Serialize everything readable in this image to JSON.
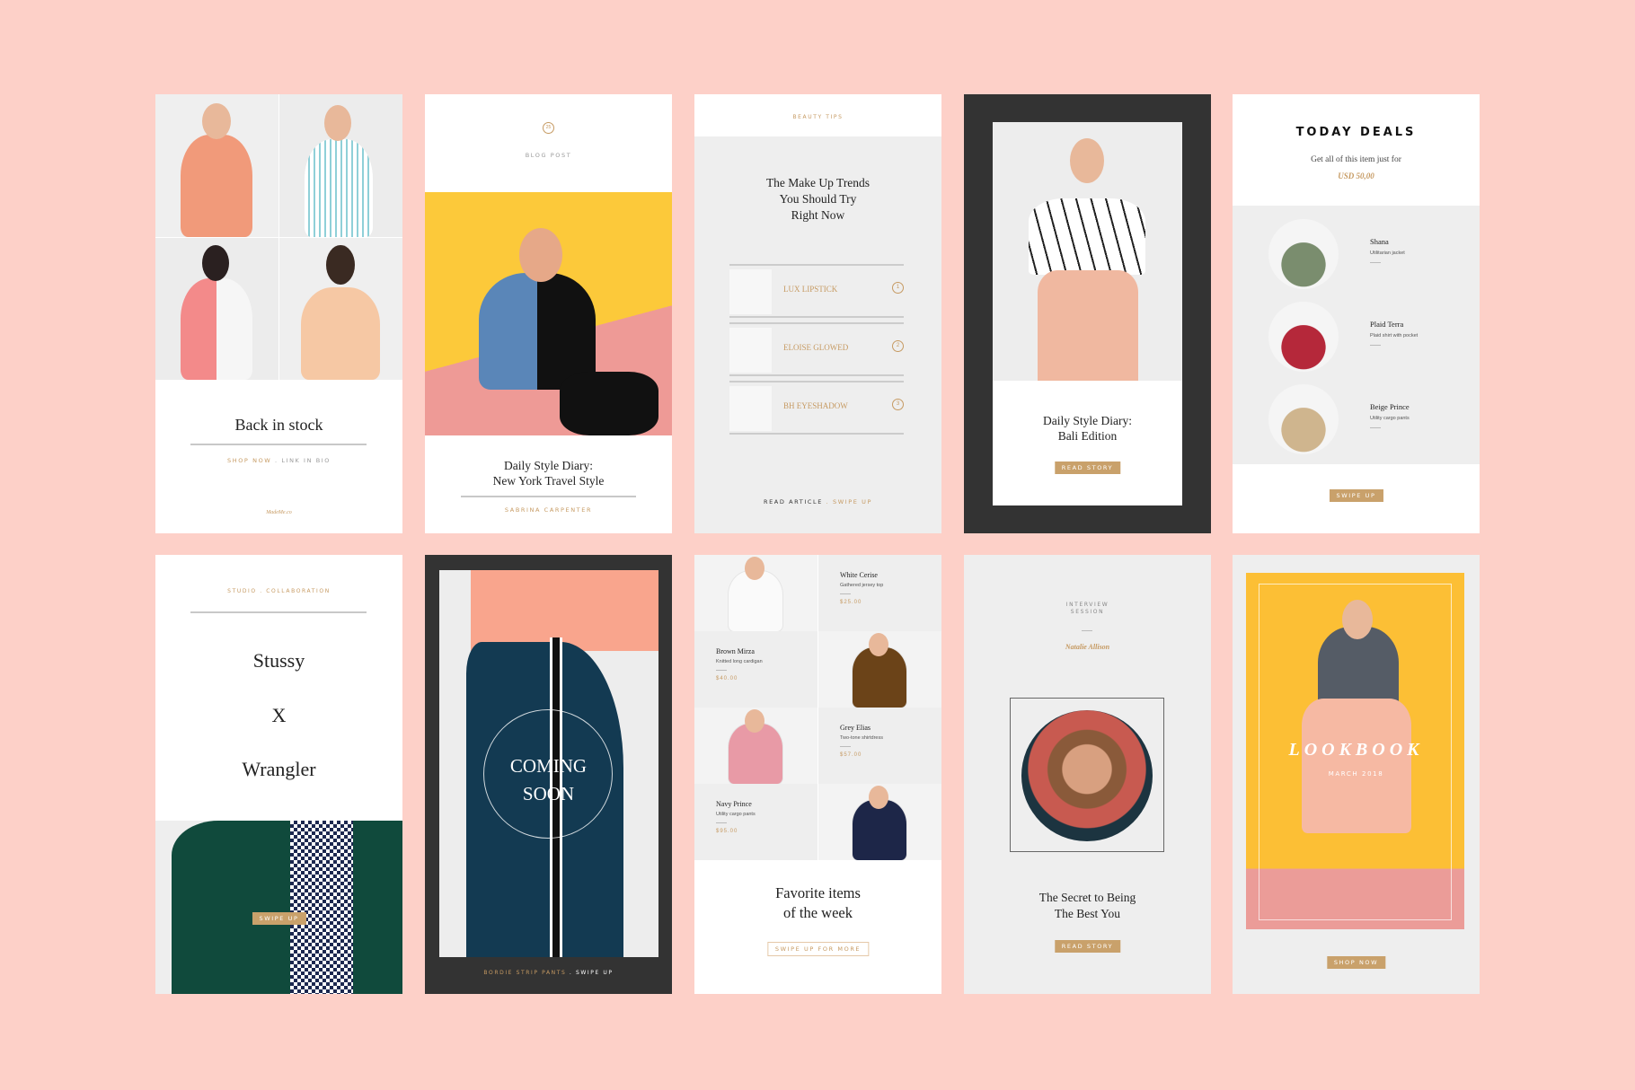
{
  "colors": {
    "background": "#fdd0c8",
    "accent": "#c9a16b",
    "dark": "#333333",
    "panel": "#eeeeee"
  },
  "back_in_stock": {
    "title": "Back in stock",
    "link_primary": "SHOP NOW",
    "link_sep": " . ",
    "link_secondary": "LINK IN BIO",
    "brand": "MadeMe.co"
  },
  "blog_post": {
    "badge": "25",
    "label": "BLOG POST",
    "title_line1": "Daily Style Diary:",
    "title_line2": "New York Travel Style",
    "author": "SABRINA CARPENTER"
  },
  "beauty_tips": {
    "label": "BEAUTY TIPS",
    "title_line1": "The Make Up Trends",
    "title_line2": "You Should Try",
    "title_line3": "Right Now",
    "items": [
      {
        "name": "LUX LIPSTICK",
        "number": "1"
      },
      {
        "name": "ELOISE GLOWED",
        "number": "2"
      },
      {
        "name": "BH EYESHADOW",
        "number": "3"
      }
    ],
    "footer_primary": "READ ARTICLE",
    "footer_sep": " . ",
    "footer_secondary": "SWIPE UP"
  },
  "bali": {
    "title_line1": "Daily Style Diary:",
    "title_line2": "Bali Edition",
    "button": "READ STORY"
  },
  "today_deals": {
    "title": "TODAY DEALS",
    "subtitle": "Get all of this item just for",
    "price": "USD 50,00",
    "items": [
      {
        "name": "Shana",
        "desc": "Utilitarian jacket"
      },
      {
        "name": "Plaid Terra",
        "desc": "Plaid shirt with pocket"
      },
      {
        "name": "Beige Prince",
        "desc": "Utility cargo pants"
      }
    ],
    "button": "SWIPE UP"
  },
  "collab": {
    "label": "STUDIO . COLLABORATION",
    "brand1": "Stussy",
    "x": "X",
    "brand2": "Wrangler",
    "button": "SWIPE UP"
  },
  "coming_soon": {
    "line1": "COMING",
    "line2": "SOON",
    "footer_primary": "BORDIE STRIP PANTS",
    "footer_sep": " . ",
    "footer_secondary": "SWIPE UP"
  },
  "favorites": {
    "items": [
      {
        "name": "White Cerise",
        "desc": "Gathered jersey top",
        "price": "$25.00"
      },
      {
        "name": "Brown Mirza",
        "desc": "Knitted long cardigan",
        "price": "$40.00"
      },
      {
        "name": "Grey Elias",
        "desc": "Two-tone shirtdress",
        "price": "$57.00"
      },
      {
        "name": "Navy Prince",
        "desc": "Utility cargo pants",
        "price": "$95.00"
      }
    ],
    "title_line1": "Favorite items",
    "title_line2": "of the week",
    "button": "SWIPE UP FOR MORE"
  },
  "interview": {
    "label_line1": "INTERVIEW",
    "label_line2": "SESSION",
    "name": "Natalie Allison",
    "title_line1": "The Secret to Being",
    "title_line2": "The Best You",
    "button": "READ STORY"
  },
  "lookbook": {
    "title": "LOOKBOOK",
    "date": "MARCH 2018",
    "button": "SHOP NOW"
  }
}
